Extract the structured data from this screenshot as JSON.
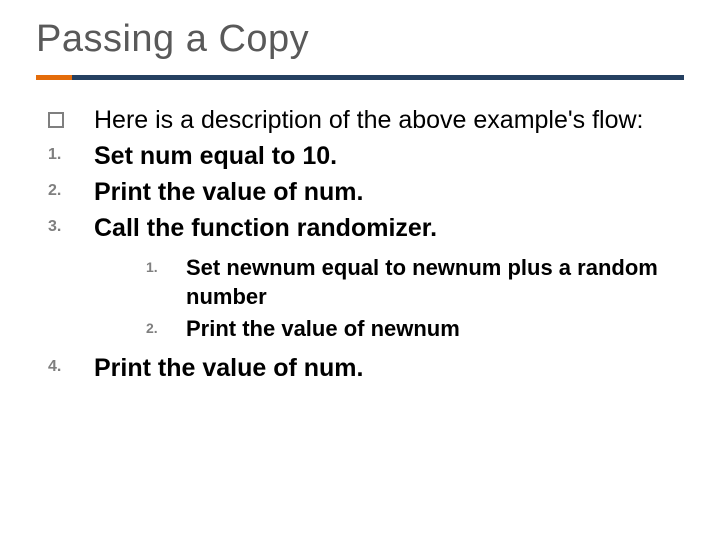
{
  "title": "Passing a Copy",
  "intro": "Here is a description of the above example's flow:",
  "list": {
    "n1": "1.",
    "t1": "Set num equal to 10.",
    "n2": "2.",
    "t2": "Print the value of num.",
    "n3": "3.",
    "t3": "Call the function randomizer.",
    "n4": "4.",
    "t4": "Print the value of num."
  },
  "sublist": {
    "n1": "1.",
    "t1": "Set newnum equal to newnum plus a random number",
    "n2": "2.",
    "t2": "Print the value of newnum"
  }
}
